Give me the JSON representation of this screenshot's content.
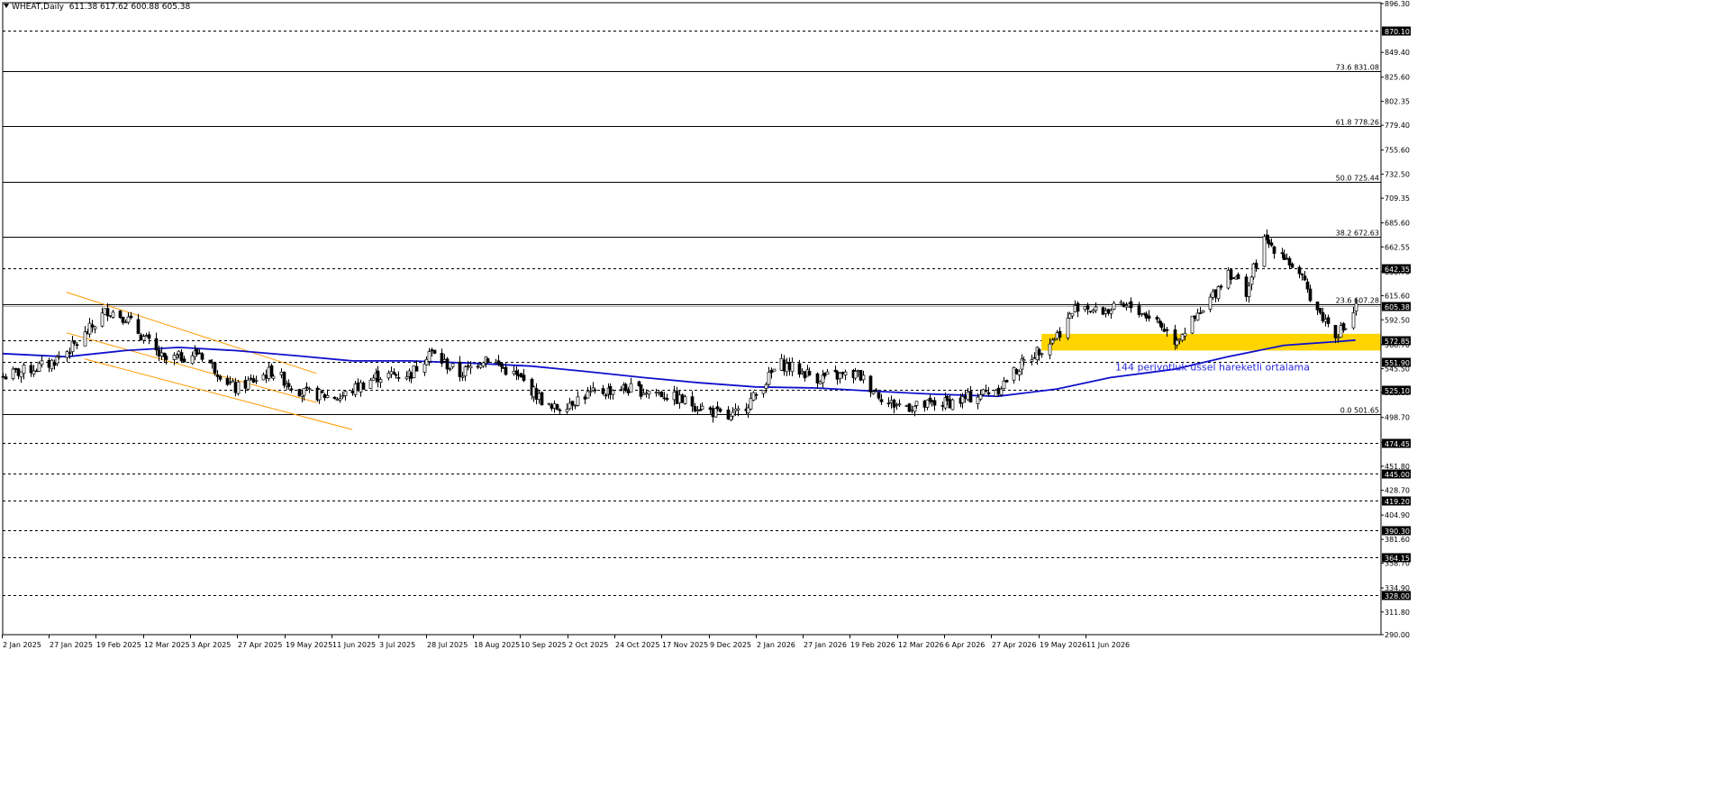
{
  "header": {
    "symbol": "WHEAT,Daily",
    "ohlc": "611.38 617.62 600.88 605.38"
  },
  "chart_data": {
    "type": "candlestick",
    "title": "WHEAT,Daily",
    "x_range": [
      "2025-01-02",
      "2026-06-26"
    ],
    "y_range": [
      290.0,
      896.3
    ],
    "x_tick_labels": [
      "2 Jan 2025",
      "27 Jan 2025",
      "19 Feb 2025",
      "12 Mar 2025",
      "3 Apr 2025",
      "27 Apr 2025",
      "19 May 2025",
      "11 Jun 2025",
      "3 Jul 2025",
      "28 Jul 2025",
      "18 Aug 2025",
      "10 Sep 2025",
      "2 Oct 2025",
      "24 Oct 2025",
      "17 Nov 2025",
      "9 Dec 2025",
      "2 Jan 2026",
      "27 Jan 2026",
      "19 Feb 2026",
      "12 Mar 2026",
      "6 Apr 2026",
      "27 Apr 2026",
      "19 May 2026",
      "11 Jun 2026"
    ],
    "y_tick_labels": [
      "896.30",
      "849.40",
      "825.60",
      "802.35",
      "779.40",
      "755.60",
      "732.50",
      "709.35",
      "685.60",
      "662.55",
      "638.70",
      "615.60",
      "592.50",
      "568.70",
      "545.50",
      "522.60",
      "498.70",
      "474.45",
      "451.80",
      "428.70",
      "404.90",
      "381.60",
      "358.70",
      "334.90",
      "311.80",
      "290.00"
    ],
    "horizontal_levels": [
      {
        "value": 870.1,
        "style": "dashed",
        "label": "870.10"
      },
      {
        "value": 642.35,
        "style": "dashed",
        "label": "642.35"
      },
      {
        "value": 572.85,
        "style": "dashed",
        "label": "572.85"
      },
      {
        "value": 551.9,
        "style": "dashed",
        "label": "551.90"
      },
      {
        "value": 525.1,
        "style": "dashed",
        "label": "525.10"
      },
      {
        "value": 474.45,
        "style": "dashed",
        "label": "474.45"
      },
      {
        "value": 445.0,
        "style": "dashed",
        "label": "445.00"
      },
      {
        "value": 419.2,
        "style": "dashed",
        "label": "419.20"
      },
      {
        "value": 390.3,
        "style": "dashed",
        "label": "390.30"
      },
      {
        "value": 364.15,
        "style": "dashed",
        "label": "364.15"
      },
      {
        "value": 328.0,
        "style": "dashed",
        "label": "328.00"
      }
    ],
    "current_price": {
      "value": 605.38,
      "label": "605.38"
    },
    "fibonacci": [
      {
        "value": 831.08,
        "label": "73.6 831.08"
      },
      {
        "value": 778.26,
        "label": "61.8 778.26"
      },
      {
        "value": 725.44,
        "label": "50.0 725.44"
      },
      {
        "value": 672.63,
        "label": "38.2 672.63"
      },
      {
        "value": 607.28,
        "label": "23.6 607.28"
      },
      {
        "value": 501.65,
        "label": "0.0 501.65"
      }
    ],
    "support_zone": {
      "low": 563.0,
      "high": 579.0,
      "x_start": "2026-02-13",
      "x_end": "2026-06-26",
      "color": "#ffd400"
    },
    "ema": {
      "label": "144 periyotluk üssel hareketli ortalama",
      "color": "#1010cc",
      "points": [
        [
          "2025-01-02",
          560
        ],
        [
          "2025-01-27",
          557
        ],
        [
          "2025-02-19",
          563
        ],
        [
          "2025-03-12",
          566
        ],
        [
          "2025-04-03",
          563
        ],
        [
          "2025-04-27",
          558
        ],
        [
          "2025-05-19",
          553
        ],
        [
          "2025-06-11",
          553
        ],
        [
          "2025-07-03",
          551
        ],
        [
          "2025-07-28",
          548
        ],
        [
          "2025-08-18",
          543
        ],
        [
          "2025-09-10",
          537
        ],
        [
          "2025-10-02",
          532
        ],
        [
          "2025-10-24",
          528
        ],
        [
          "2025-11-17",
          527
        ],
        [
          "2025-12-09",
          524
        ],
        [
          "2026-01-02",
          521
        ],
        [
          "2026-01-27",
          519
        ],
        [
          "2026-02-19",
          526
        ],
        [
          "2026-03-12",
          537
        ],
        [
          "2026-04-06",
          545
        ],
        [
          "2026-04-27",
          557
        ],
        [
          "2026-05-19",
          568
        ],
        [
          "2026-06-11",
          572
        ],
        [
          "2026-06-16",
          573
        ]
      ]
    },
    "channel": {
      "color": "#ff9900",
      "upper": [
        [
          "2025-01-27",
          619
        ],
        [
          "2025-05-05",
          541
        ]
      ],
      "middle": [
        [
          "2025-01-27",
          580
        ],
        [
          "2025-05-05",
          513
        ]
      ],
      "lower": [
        [
          "2025-02-03",
          555
        ],
        [
          "2025-05-19",
          487
        ]
      ]
    },
    "price_path": [
      [
        "2025-01-02",
        538
      ],
      [
        "2025-01-20",
        550
      ],
      [
        "2025-01-31",
        570
      ],
      [
        "2025-02-12",
        602
      ],
      [
        "2025-02-19",
        595
      ],
      [
        "2025-03-06",
        553
      ],
      [
        "2025-03-20",
        561
      ],
      [
        "2025-04-03",
        526
      ],
      [
        "2025-04-17",
        543
      ],
      [
        "2025-04-30",
        522
      ],
      [
        "2025-05-14",
        518
      ],
      [
        "2025-05-28",
        538
      ],
      [
        "2025-06-11",
        541
      ],
      [
        "2025-06-18",
        562
      ],
      [
        "2025-06-30",
        540
      ],
      [
        "2025-07-10",
        557
      ],
      [
        "2025-07-24",
        535
      ],
      [
        "2025-08-05",
        506
      ],
      [
        "2025-08-18",
        520
      ],
      [
        "2025-09-01",
        527
      ],
      [
        "2025-09-15",
        523
      ],
      [
        "2025-10-01",
        510
      ],
      [
        "2025-10-14",
        497
      ],
      [
        "2025-10-24",
        520
      ],
      [
        "2025-11-02",
        551
      ],
      [
        "2025-11-17",
        537
      ],
      [
        "2025-12-03",
        540
      ],
      [
        "2025-12-15",
        512
      ],
      [
        "2025-12-26",
        509
      ],
      [
        "2026-01-12",
        515
      ],
      [
        "2026-01-27",
        527
      ],
      [
        "2026-02-06",
        552
      ],
      [
        "2026-02-19",
        578
      ],
      [
        "2026-02-28",
        610
      ],
      [
        "2026-03-06",
        600
      ],
      [
        "2026-03-20",
        605
      ],
      [
        "2026-03-30",
        592
      ],
      [
        "2026-04-06",
        573
      ],
      [
        "2026-04-17",
        600
      ],
      [
        "2026-04-27",
        640
      ],
      [
        "2026-05-04",
        620
      ],
      [
        "2026-05-11",
        668
      ],
      [
        "2026-05-18",
        658
      ],
      [
        "2026-05-26",
        630
      ],
      [
        "2026-06-02",
        598
      ],
      [
        "2026-06-08",
        580
      ],
      [
        "2026-06-12",
        585
      ],
      [
        "2026-06-16",
        605
      ]
    ]
  }
}
